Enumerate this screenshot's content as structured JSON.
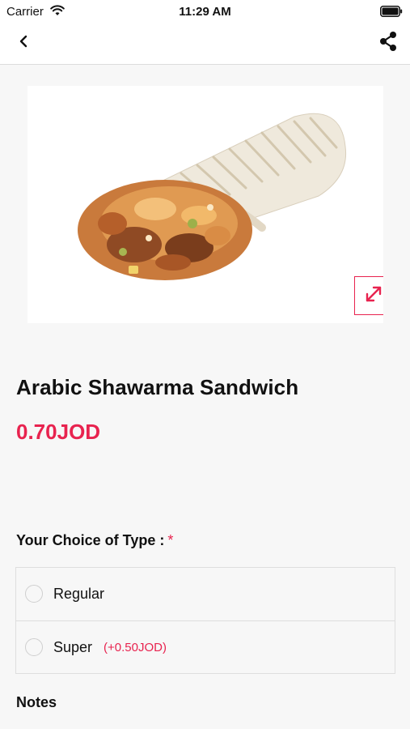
{
  "status_bar": {
    "carrier": "Carrier",
    "time": "11:29 AM"
  },
  "nav": {
    "back_icon": "chevron-left-icon",
    "share_icon": "share-icon"
  },
  "product": {
    "image": "shawarma-wrap-photo",
    "title": "Arabic Shawarma Sandwich",
    "price": "0.70JOD"
  },
  "choice": {
    "label": "Your Choice of Type :",
    "required_marker": "*",
    "options": [
      {
        "label": "Regular",
        "extra": ""
      },
      {
        "label": "Super",
        "extra": "(+0.50JOD)"
      }
    ]
  },
  "notes": {
    "label": "Notes"
  },
  "colors": {
    "accent": "#e8234f",
    "background": "#f7f7f7"
  }
}
